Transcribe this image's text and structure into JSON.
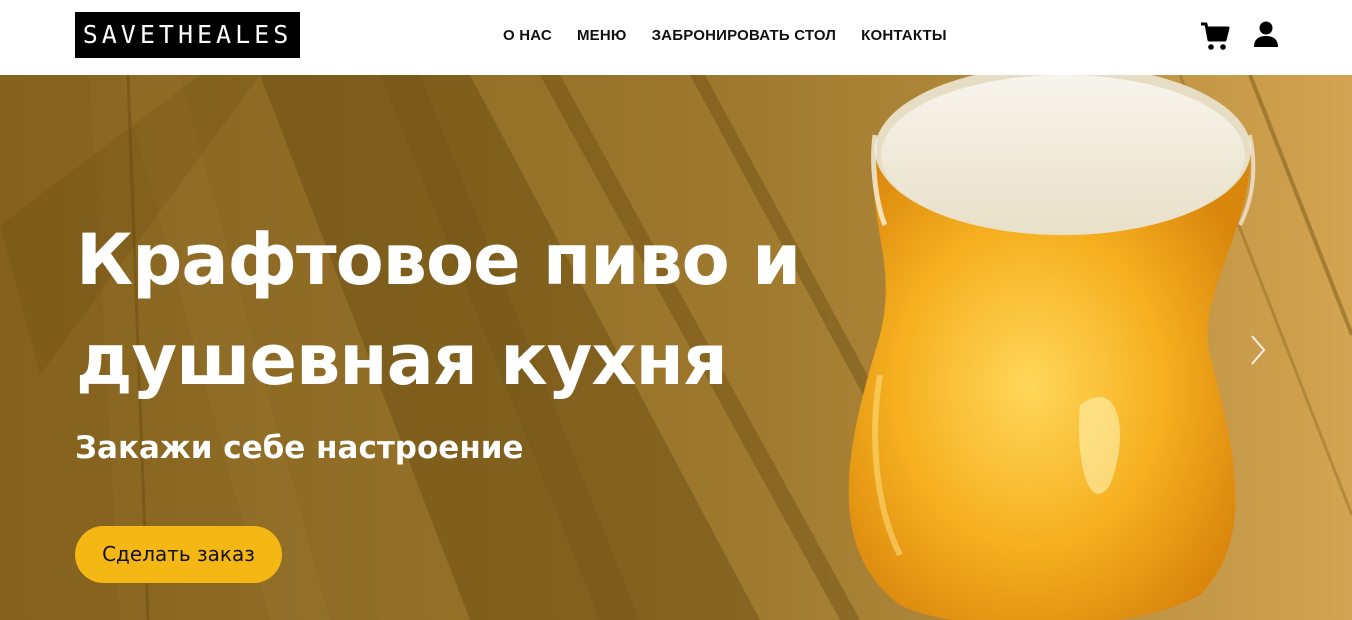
{
  "header": {
    "logo_text": "SAVETHEALES",
    "nav": [
      {
        "label": "О НАС"
      },
      {
        "label": "МЕНЮ"
      },
      {
        "label": "ЗАБРОНИРОВАТЬ СТОЛ"
      },
      {
        "label": "КОНТАКТЫ"
      }
    ],
    "icons": {
      "cart": "cart-icon",
      "user": "user-icon"
    }
  },
  "hero": {
    "title_line1": "Крафтовое пиво и",
    "title_line2": "душевная кухня",
    "subtitle": "Закажи себе настроение",
    "cta_label": "Сделать заказ",
    "next_icon": "chevron-right-icon"
  },
  "colors": {
    "accent": "#f5b714",
    "header_bg": "#ffffff",
    "logo_bg": "#000000",
    "hero_overlay": "#7a5a10",
    "beer": "#f2a516",
    "foam": "#f3efe6"
  }
}
